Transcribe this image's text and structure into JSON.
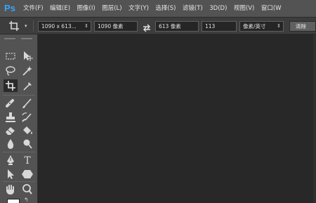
{
  "app": {
    "logo": "Ps"
  },
  "menu": {
    "items": [
      "文件(F)",
      "编辑(E)",
      "图像(I)",
      "图层(L)",
      "文字(Y)",
      "选择(S)",
      "滤镜(T)",
      "3D(D)",
      "视图(V)",
      "窗口(W"
    ]
  },
  "options": {
    "tool_icon": "crop-icon",
    "preset": "1090 x 613...",
    "width": "1090 像素",
    "height": "613 像素",
    "resolution": "113",
    "unit": "像素/英寸",
    "clear_button": "清除"
  },
  "toolbar": {
    "tools": [
      {
        "name": "marquee-tool",
        "icon": "marquee-icon"
      },
      {
        "name": "move-tool",
        "icon": "move-icon"
      },
      {
        "name": "lasso-tool",
        "icon": "lasso-icon"
      },
      {
        "name": "magic-wand-tool",
        "icon": "magic-wand-icon"
      },
      {
        "name": "crop-tool",
        "icon": "crop-icon",
        "active": true
      },
      {
        "name": "eyedropper-tool",
        "icon": "eyedropper-icon"
      },
      {
        "name": "healing-brush-tool",
        "icon": "bandage-icon"
      },
      {
        "name": "brush-tool",
        "icon": "brush-icon"
      },
      {
        "name": "clone-stamp-tool",
        "icon": "stamp-icon"
      },
      {
        "name": "history-brush-tool",
        "icon": "history-brush-icon"
      },
      {
        "name": "eraser-tool",
        "icon": "eraser-icon"
      },
      {
        "name": "paint-bucket-tool",
        "icon": "paint-bucket-icon"
      },
      {
        "name": "blur-tool",
        "icon": "blur-icon"
      },
      {
        "name": "dodge-tool",
        "icon": "dodge-icon"
      },
      {
        "name": "pen-tool",
        "icon": "pen-icon"
      },
      {
        "name": "type-tool",
        "icon": "type-icon",
        "glyph": "T"
      },
      {
        "name": "path-selection-tool",
        "icon": "path-selection-icon"
      },
      {
        "name": "shape-tool",
        "icon": "hexagon-icon"
      },
      {
        "name": "hand-tool",
        "icon": "hand-icon"
      },
      {
        "name": "zoom-tool",
        "icon": "zoom-icon"
      }
    ],
    "foreground_color": "#ffffff"
  },
  "colors": {
    "accent": "#31a8ff",
    "canvas": "#282828",
    "panel": "#535353"
  }
}
